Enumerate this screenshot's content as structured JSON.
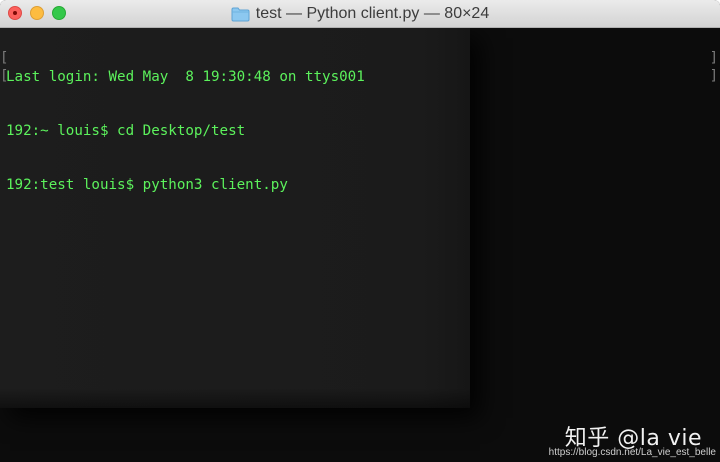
{
  "window": {
    "title": "test — Python client.py — 80×24",
    "traffic_lights": [
      "close",
      "minimize",
      "maximize"
    ],
    "title_icon": "folder-icon"
  },
  "terminal": {
    "text_color": "#5cf25c",
    "lines": [
      "Last login: Wed May  8 19:30:48 on ttys001",
      "192:~ louis$ cd Desktop/test",
      "192:test louis$ python3 client.py"
    ],
    "bracket_left": "[",
    "bracket_right": "]"
  },
  "watermark": {
    "brand": "知乎 @la vie",
    "url": "https://blog.csdn.net/La_vie_est_belle"
  }
}
